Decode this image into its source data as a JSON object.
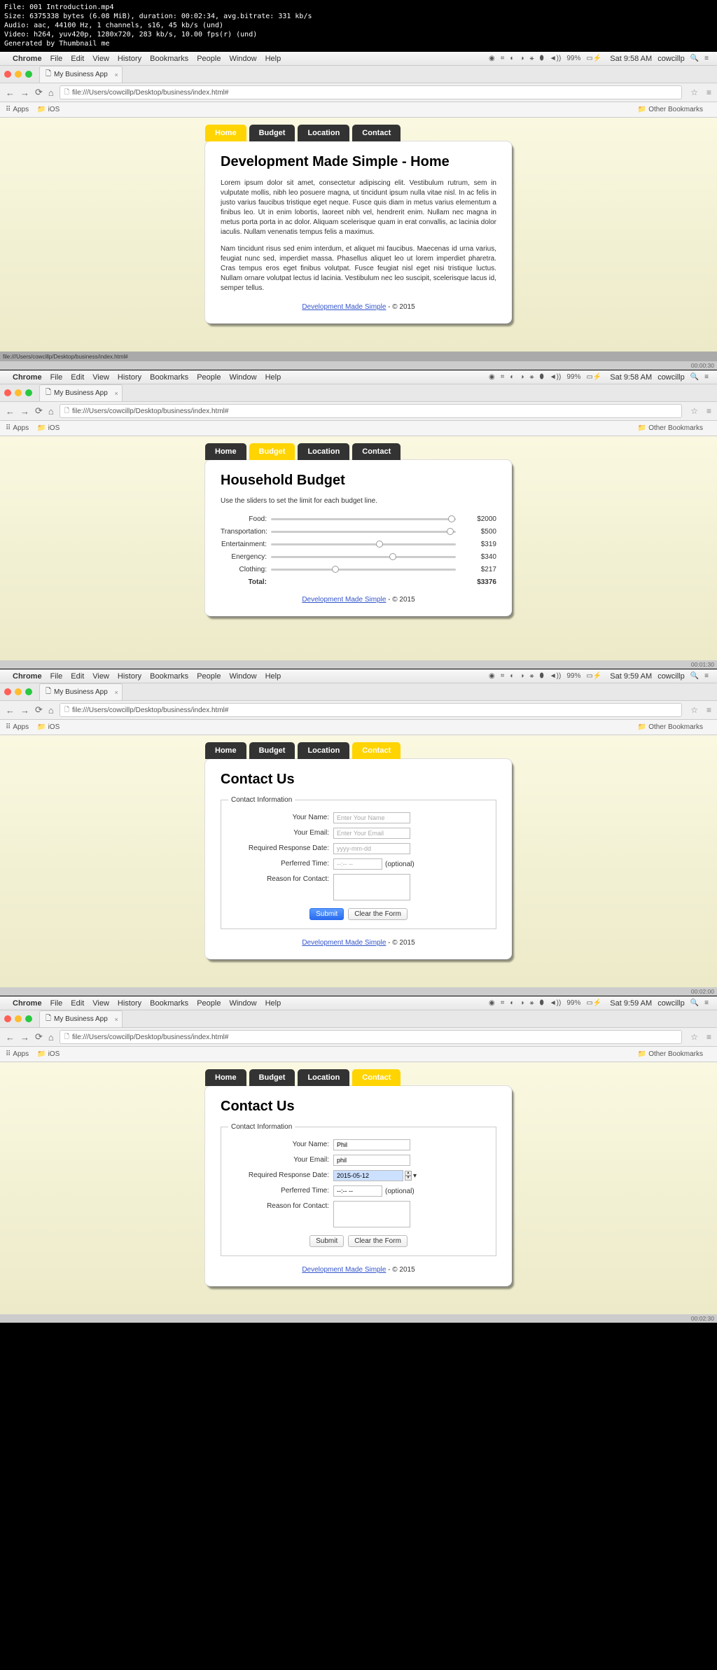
{
  "file_info": {
    "l1": "File: 001 Introduction.mp4",
    "l2": "Size: 6375338 bytes (6.08 MiB), duration: 00:02:34, avg.bitrate: 331 kb/s",
    "l3": "Audio: aac, 44100 Hz, 1 channels, s16, 45 kb/s (und)",
    "l4": "Video: h264, yuv420p, 1280x720, 283 kb/s, 10.00 fps(r) (und)",
    "l5": "Generated by Thumbnail me"
  },
  "menubar": {
    "app": "Chrome",
    "items": [
      "File",
      "Edit",
      "View",
      "History",
      "Bookmarks",
      "People",
      "Window",
      "Help"
    ],
    "battery": "99%",
    "user": "cowcillp"
  },
  "times": [
    "Sat 9:58 AM",
    "Sat 9:58 AM",
    "Sat 9:59 AM",
    "Sat 9:59 AM"
  ],
  "tab_title": "My Business App",
  "url": "file:///Users/cowcillp/Desktop/business/index.html#",
  "bookmarks": {
    "apps": "Apps",
    "ios": "iOS",
    "other": "Other Bookmarks"
  },
  "nav": {
    "home": "Home",
    "budget": "Budget",
    "location": "Location",
    "contact": "Contact"
  },
  "footer": {
    "link": "Development Made Simple",
    "suffix": " - © 2015"
  },
  "status_url": "file:///Users/cowcillp/Desktop/business/index.html#",
  "timestamps": [
    "00:00:30",
    "00:01:30",
    "00:02:00",
    "00:02:30"
  ],
  "frame1": {
    "title": "Development Made Simple - Home",
    "p1": "Lorem ipsum dolor sit amet, consectetur adipiscing elit. Vestibulum rutrum, sem in vulputate mollis, nibh leo posuere magna, ut tincidunt ipsum nulla vitae nisl. In ac felis in justo varius faucibus tristique eget neque. Fusce quis diam in metus varius elementum a finibus leo. Ut in enim lobortis, laoreet nibh vel, hendrerit enim. Nullam nec magna in metus porta porta in ac dolor. Aliquam scelerisque quam in erat convallis, ac lacinia dolor iaculis. Nullam venenatis tempus felis a maximus.",
    "p2": "Nam tincidunt risus sed enim interdum, et aliquet mi faucibus. Maecenas id urna varius, feugiat nunc sed, imperdiet massa. Phasellus aliquet leo ut lorem imperdiet pharetra. Cras tempus eros eget finibus volutpat. Fusce feugiat nisl eget nisi tristique luctus. Nullam ornare volutpat lectus id lacinia. Vestibulum nec leo suscipit, scelerisque lacus id, semper tellus."
  },
  "frame2": {
    "title": "Household Budget",
    "instr": "Use the sliders to set the limit for each budget line.",
    "rows": [
      {
        "label": "Food:",
        "value": "$2000",
        "pct": 96
      },
      {
        "label": "Transportation:",
        "value": "$500",
        "pct": 95
      },
      {
        "label": "Entertainment:",
        "value": "$319",
        "pct": 57
      },
      {
        "label": "Energency:",
        "value": "$340",
        "pct": 64
      },
      {
        "label": "Clothing:",
        "value": "$217",
        "pct": 33
      }
    ],
    "total_label": "Total:",
    "total_value": "$3376"
  },
  "frame3": {
    "title": "Contact Us",
    "legend": "Contact Information",
    "labels": {
      "name": "Your Name:",
      "email": "Your Email:",
      "date": "Required Response Date:",
      "time": "Perferred Time:",
      "reason": "Reason for Contact:",
      "optional": "(optional)"
    },
    "placeholders": {
      "name": "Enter Your Name",
      "email": "Enter Your Email",
      "date": "yyyy-mm-dd",
      "time": "--:-- --"
    },
    "submit": "Submit",
    "clear": "Clear the Form"
  },
  "frame4": {
    "values": {
      "name": "Phil",
      "email": "phil",
      "date": "2015-05-12",
      "time": "--:-- --"
    }
  }
}
